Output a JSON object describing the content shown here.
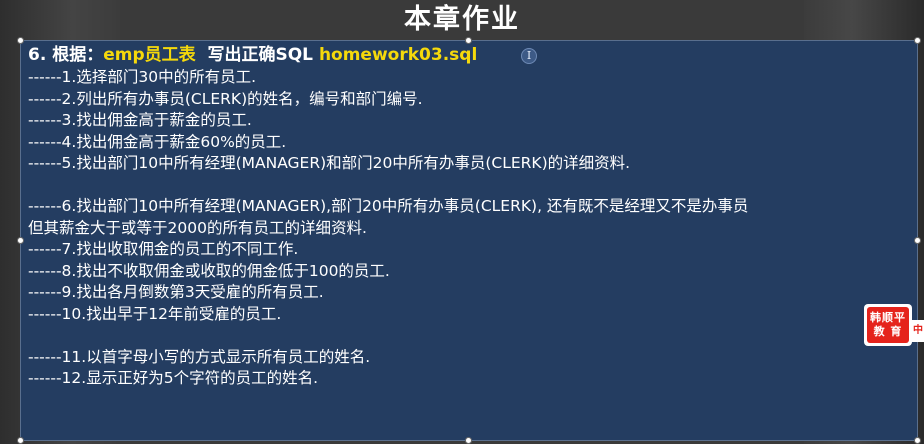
{
  "slide": {
    "title": "本章作业",
    "heading": {
      "prefix": "6. 根据：",
      "table": "emp员工表",
      "middle": "  写出正确SQL ",
      "file": "homework03.sql"
    },
    "lines": [
      "------1.选择部门30中的所有员工.",
      "------2.列出所有办事员(CLERK)的姓名，编号和部门编号.",
      "------3.找出佣金高于薪金的员工.",
      "------4.找出佣金高于薪金60%的员工.",
      "------5.找出部门10中所有经理(MANAGER)和部门20中所有办事员(CLERK)的详细资料.",
      "",
      "------6.找出部门10中所有经理(MANAGER),部门20中所有办事员(CLERK), 还有既不是经理又不是办事员",
      "但其薪金大于或等于2000的所有员工的详细资料.",
      "------7.找出收取佣金的员工的不同工作.",
      "------8.找出不收取佣金或收取的佣金低于100的员工.",
      "------9.找出各月倒数第3天受雇的所有员工.",
      "------10.找出早于12年前受雇的员工.",
      "",
      "------11.以首字母小写的方式显示所有员工的姓名.",
      "------12.显示正好为5个字符的员工的姓名."
    ]
  },
  "text_cursor": {
    "glyph": "I",
    "icon": "text-cursor-icon"
  },
  "logo": {
    "line1": "韩顺平",
    "line2": "教 育",
    "tail": "中"
  },
  "colors": {
    "panel": "#243d61",
    "accent": "#f5d90b",
    "text": "#ffffff",
    "logo": "#e5231b"
  }
}
